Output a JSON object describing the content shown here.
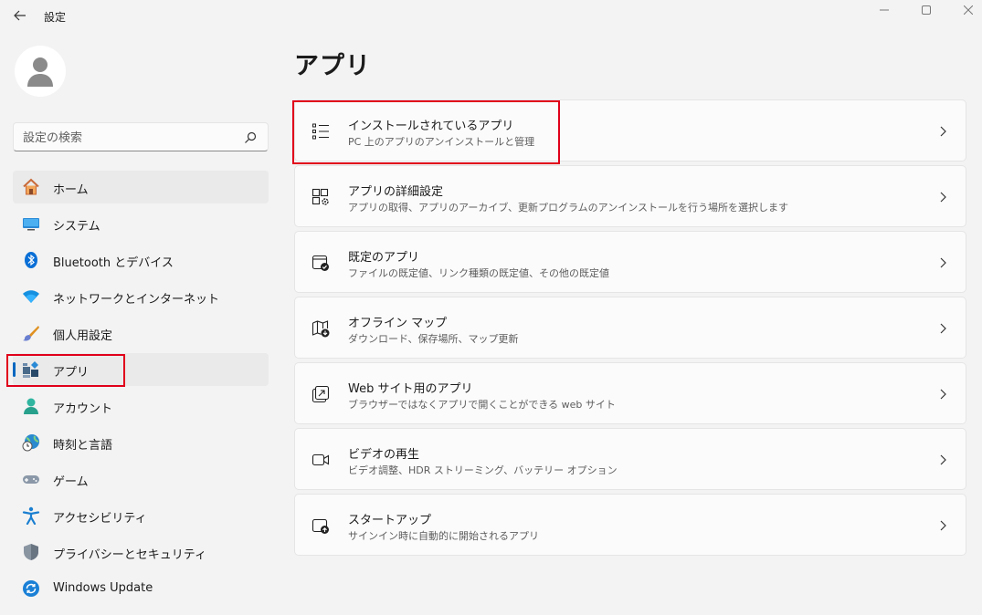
{
  "window": {
    "title": "設定"
  },
  "search": {
    "placeholder": "設定の検索"
  },
  "sidebar": {
    "items": [
      {
        "label": "ホーム",
        "icon": "home-icon"
      },
      {
        "label": "システム",
        "icon": "system-icon"
      },
      {
        "label": "Bluetooth とデバイス",
        "icon": "bluetooth-icon"
      },
      {
        "label": "ネットワークとインターネット",
        "icon": "wifi-icon"
      },
      {
        "label": "個人用設定",
        "icon": "brush-icon"
      },
      {
        "label": "アプリ",
        "icon": "apps-icon",
        "selected": true
      },
      {
        "label": "アカウント",
        "icon": "account-icon"
      },
      {
        "label": "時刻と言語",
        "icon": "time-language-icon"
      },
      {
        "label": "ゲーム",
        "icon": "gamepad-icon"
      },
      {
        "label": "アクセシビリティ",
        "icon": "accessibility-icon"
      },
      {
        "label": "プライバシーとセキュリティ",
        "icon": "shield-icon"
      },
      {
        "label": "Windows Update",
        "icon": "windows-update-icon"
      }
    ]
  },
  "main": {
    "title": "アプリ",
    "cards": [
      {
        "title": "インストールされているアプリ",
        "subtitle": "PC 上のアプリのアンインストールと管理",
        "icon": "list-icon"
      },
      {
        "title": "アプリの詳細設定",
        "subtitle": "アプリの取得、アプリのアーカイブ、更新プログラムのアンインストールを行う場所を選択します",
        "icon": "advanced-apps-icon"
      },
      {
        "title": "既定のアプリ",
        "subtitle": "ファイルの既定値、リンク種類の既定値、その他の既定値",
        "icon": "default-apps-icon"
      },
      {
        "title": "オフライン マップ",
        "subtitle": "ダウンロード、保存場所、マップ更新",
        "icon": "offline-map-icon"
      },
      {
        "title": "Web サイト用のアプリ",
        "subtitle": "ブラウザーではなくアプリで開くことができる web サイト",
        "icon": "open-external-icon"
      },
      {
        "title": "ビデオの再生",
        "subtitle": "ビデオ調整、HDR ストリーミング、バッテリー オプション",
        "icon": "video-icon"
      },
      {
        "title": "スタートアップ",
        "subtitle": "サインイン時に自動的に開始されるアプリ",
        "icon": "startup-icon"
      }
    ]
  },
  "colors": {
    "accent": "#0067c0",
    "highlight": "#e0001a",
    "background": "#f3f3f3",
    "card": "#fbfbfb"
  }
}
